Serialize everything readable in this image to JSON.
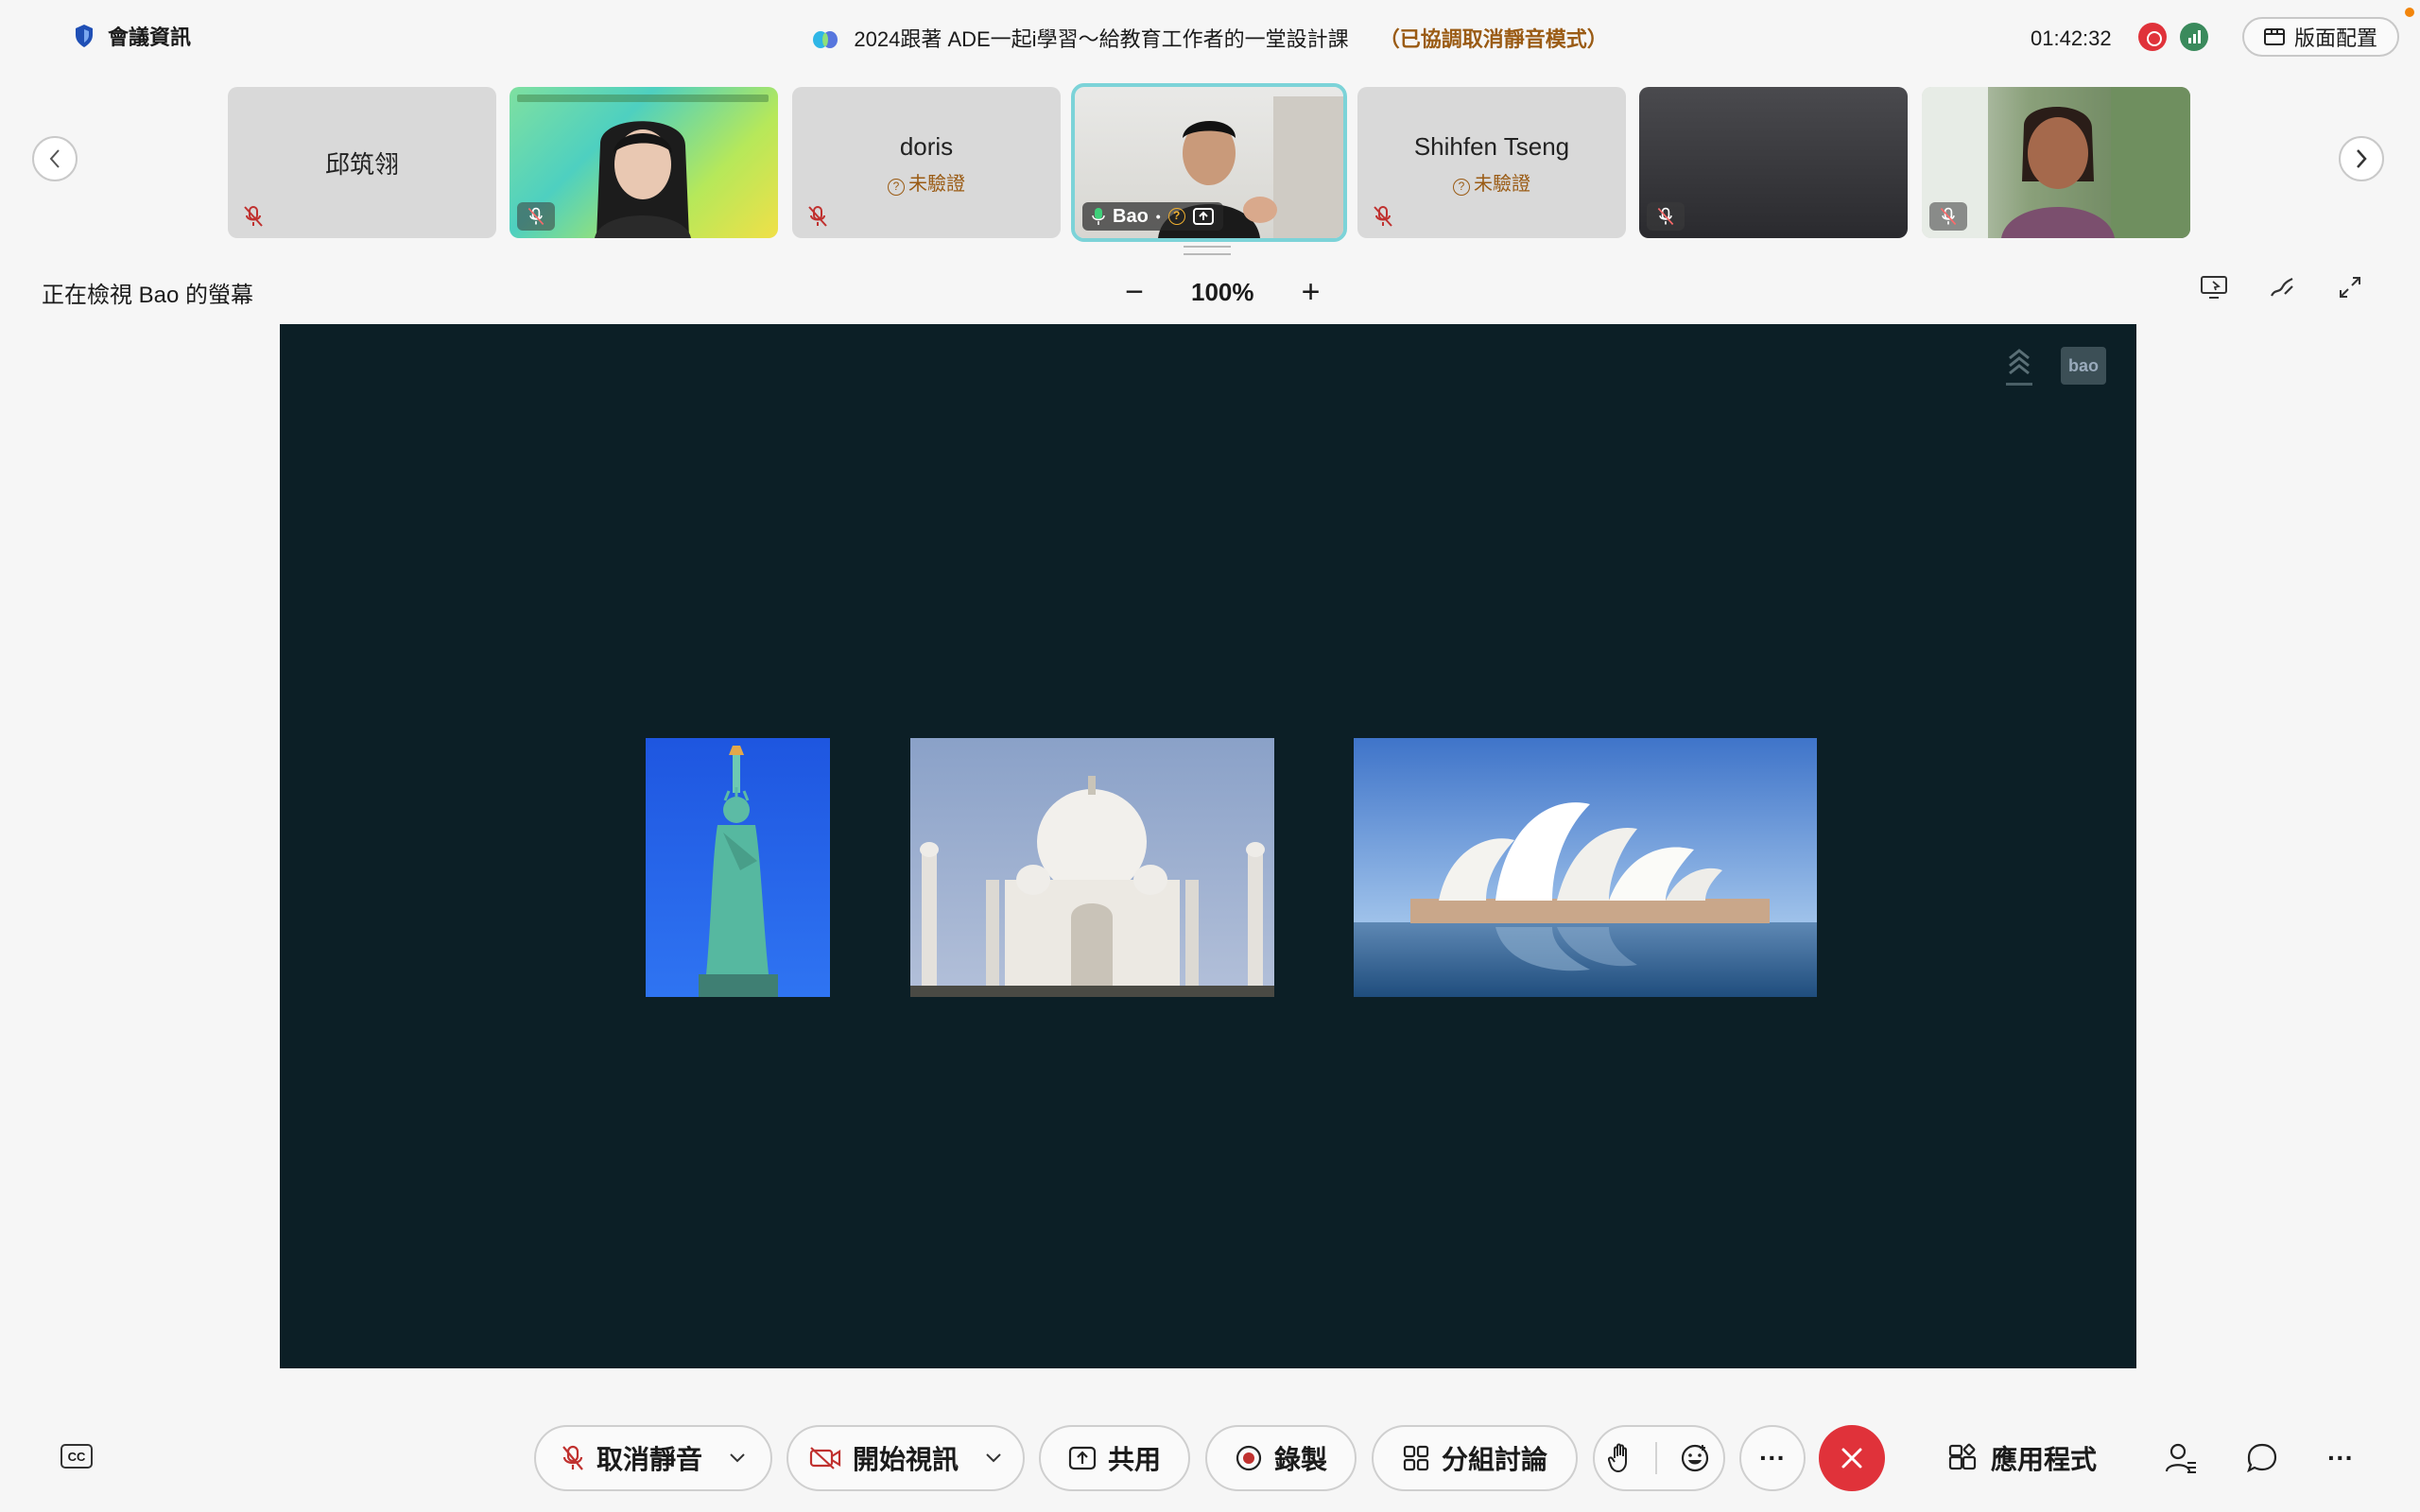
{
  "header": {
    "meeting_info": "會議資訊",
    "title": "2024跟著 ADE一起i學習～給教育工作者的一堂設計課",
    "mute_status": "（已協調取消靜音模式）",
    "timer": "01:42:32",
    "layout_label": "版面配置"
  },
  "participants": [
    {
      "name": "邱筑翎",
      "status": ""
    },
    {
      "name": "",
      "status": ""
    },
    {
      "name": "doris",
      "status": "未驗證"
    },
    {
      "name": "Bao",
      "status": ""
    },
    {
      "name": "Shihfen Tseng",
      "status": "未驗證"
    },
    {
      "name": "",
      "status": ""
    },
    {
      "name": "",
      "status": ""
    }
  ],
  "viewer": {
    "label": "正在檢視 Bao 的螢幕",
    "zoom": "100%",
    "zoom_out": "−",
    "zoom_in": "+"
  },
  "shared_screen": {
    "watermark_label": "bao",
    "photos": [
      "statue-of-liberty",
      "taj-mahal",
      "sydney-opera-house"
    ]
  },
  "toolbar": {
    "cc_label": "CC",
    "unmute": "取消靜音",
    "start_video": "開始視訊",
    "share": "共用",
    "record": "錄製",
    "breakout": "分組討論",
    "more": "···",
    "apps": "應用程式",
    "overflow": "···"
  },
  "colors": {
    "accent_red": "#e0323a",
    "screen_bg": "#0c1f26",
    "active_outline": "#7cd3d8",
    "warning_text": "#9a5b14"
  }
}
